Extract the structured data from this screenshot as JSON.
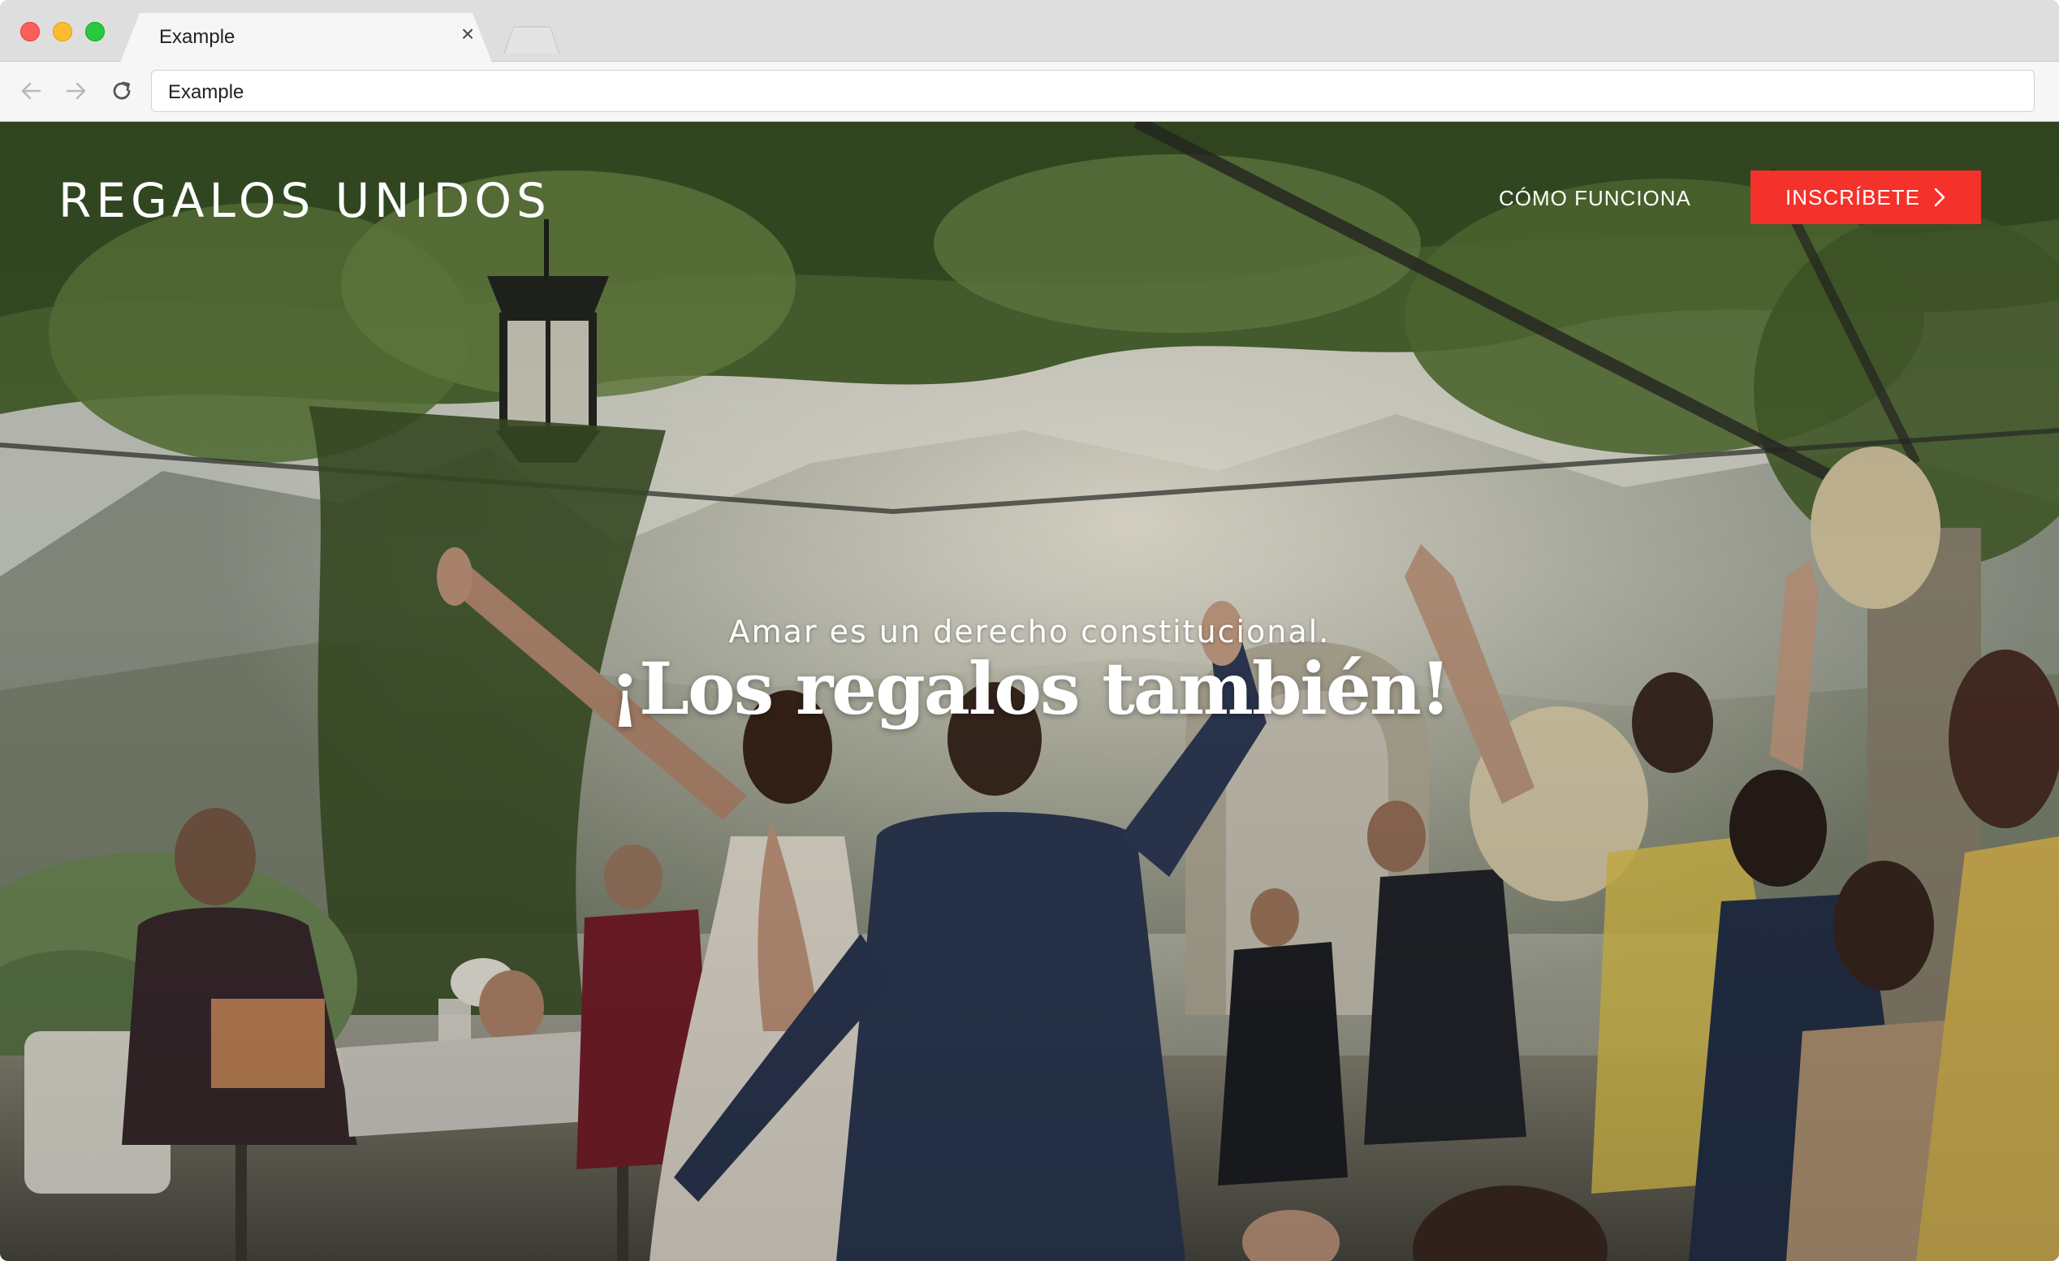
{
  "browser": {
    "tab_title": "Example",
    "tab_close": "×",
    "address": "Example"
  },
  "site": {
    "logo_text": "REGALOS UNIDOS",
    "nav_link": "CÓMO FUNCIONA",
    "cta_label": "INSCRÍBETE"
  },
  "hero": {
    "subtitle": "Amar es un derecho constitucional.",
    "headline": "¡Los regalos también!"
  },
  "colors": {
    "cta": "#f4312a",
    "hero_text": "#ffffff",
    "chrome": "#dedede"
  },
  "icons": {
    "back": "back-arrow-icon",
    "forward": "forward-arrow-icon",
    "reload": "reload-icon",
    "cta_chevron": "chevron-right-icon",
    "tab_close": "close-icon"
  }
}
